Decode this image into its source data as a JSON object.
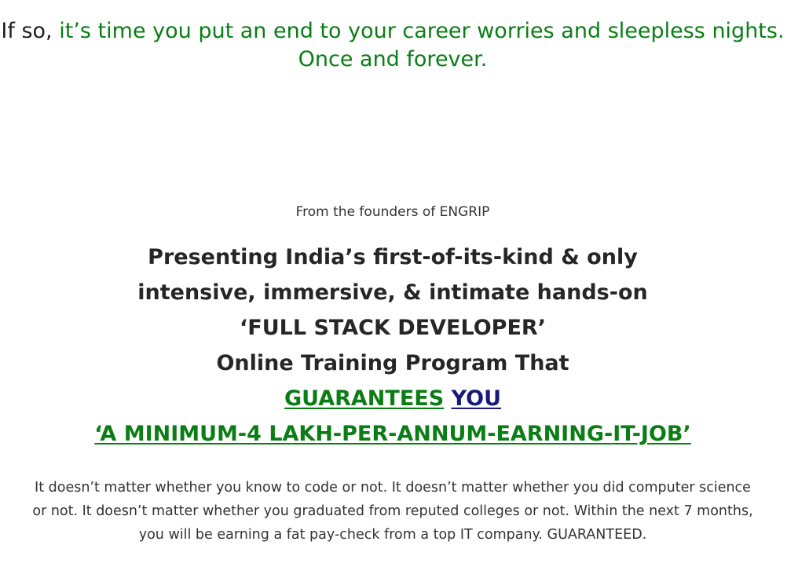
{
  "intro": {
    "lead": "If so, ",
    "highlight": "it’s time you put an end to your career worries and sleepless nights. Once and forever."
  },
  "founders_line": "From the founders of ENGRIP",
  "headline": {
    "line1": "Presenting India’s first-of-its-kind & only",
    "line2": "intensive, immersive, & intimate hands-on",
    "line3": "‘FULL STACK DEVELOPER’",
    "line4": "Online Training Program That",
    "guarantees": "GUARANTEES",
    "you": "YOU",
    "job_link": "‘A MINIMUM-4 LAKH-PER-ANNUM-EARNING-IT-JOB’"
  },
  "body_text": "It doesn’t matter whether you know to code or not. It doesn’t matter whether you did computer science or not. It doesn’t matter whether you graduated from reputed colleges or not. Within the next 7 months, you will be earning a fat pay-check from a top IT company. GUARANTEED.",
  "colors": {
    "green": "#0a7d14",
    "blue": "#1a1a7a",
    "text": "#262626"
  }
}
